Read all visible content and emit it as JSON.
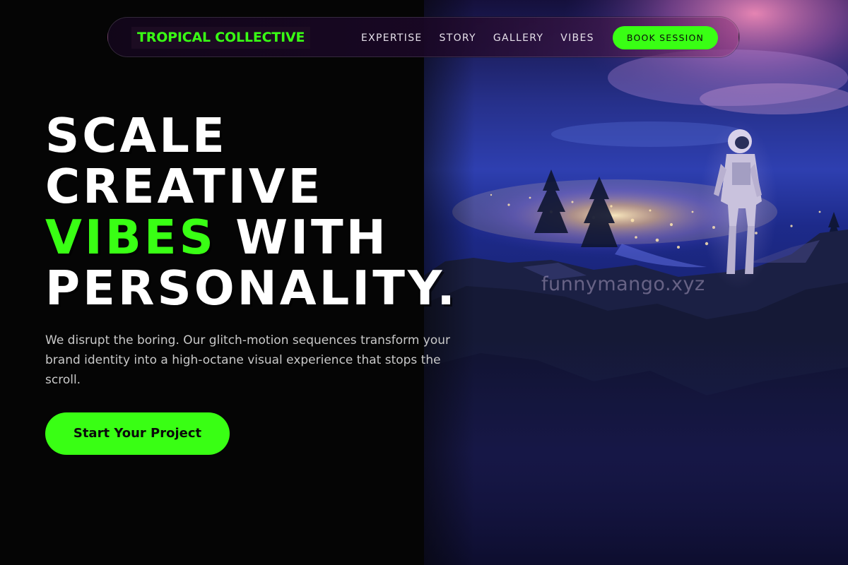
{
  "nav": {
    "brand": "TROPICAL COLLECTIVE",
    "links": [
      "EXPERTISE",
      "STORY",
      "GALLERY",
      "VIBES"
    ],
    "cta": "BOOK SESSION"
  },
  "hero": {
    "headline": {
      "line1": "SCALE",
      "line2": "CREATIVE",
      "line3_accent": "VIBES",
      "line3_rest": " WITH",
      "line4": "PERSONALITY."
    },
    "description": "We disrupt the boring. Our glitch-motion sequences transform your brand identity into a high-octane visual experience that stops the scroll.",
    "cta": "Start Your Project",
    "image_watermark": "funnymango.xyz"
  },
  "colors": {
    "accent": "#39ff14",
    "background": "#050505",
    "text": "#ffffff",
    "muted_text": "#c9c9c9"
  }
}
